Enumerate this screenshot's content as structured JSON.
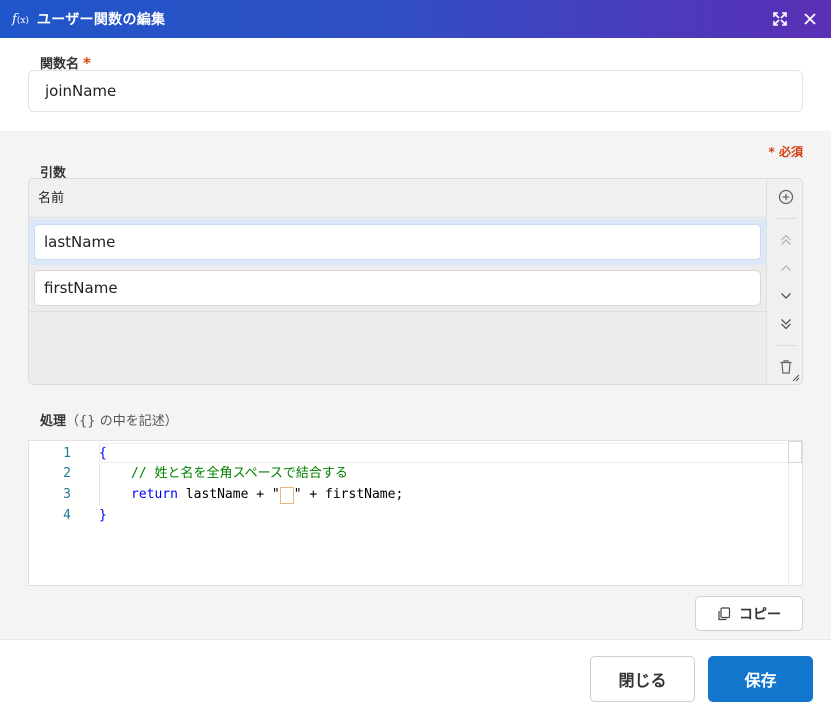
{
  "window": {
    "icon_text": "f",
    "icon_sub": "(x)",
    "title": "ユーザー関数の編集"
  },
  "function_name": {
    "label": "関数名",
    "required_mark": "*",
    "value": "joinName"
  },
  "required_note": "* 必須",
  "args": {
    "label": "引数",
    "column_header": "名前",
    "rows": [
      {
        "value": "lastName",
        "selected": true
      },
      {
        "value": "firstName",
        "selected": false
      }
    ],
    "side_buttons": [
      "add-icon",
      "move-top-icon",
      "move-up-icon",
      "move-down-icon",
      "move-bottom-icon",
      "trash-icon"
    ]
  },
  "process": {
    "label": "処理",
    "hint": "（{} の中を記述）",
    "lines": [
      {
        "num": "1",
        "text": "{"
      },
      {
        "num": "2",
        "comment": "// 姓と名を全角スペースで結合する"
      },
      {
        "num": "3",
        "keyword": "return",
        "before": " lastName + \"",
        "fullwidth_space": "　",
        "after": "\" + firstName;"
      },
      {
        "num": "4",
        "text": "}"
      }
    ]
  },
  "copy_button": "コピー",
  "footer": {
    "close": "閉じる",
    "save": "保存"
  },
  "colors": {
    "title_gradient_start": "#1f56c9",
    "title_gradient_end": "#5b2fb6",
    "required": "#d64012",
    "primary_button": "#1376cd",
    "selected_row": "#dbe8f8"
  }
}
